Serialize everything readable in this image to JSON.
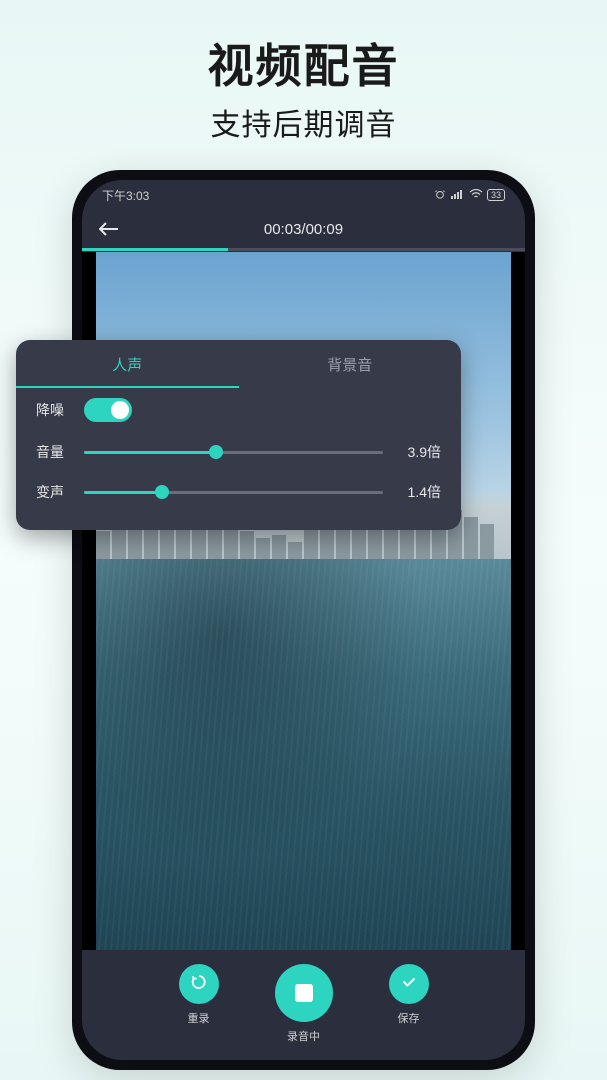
{
  "promo": {
    "title": "视频配音",
    "subtitle": "支持后期调音"
  },
  "status": {
    "time": "下午3:03",
    "battery": "33"
  },
  "header": {
    "timecode": "00:03/00:09"
  },
  "progress": {
    "percent": 33
  },
  "panel": {
    "tabs": {
      "voice": "人声",
      "bgm": "背景音"
    },
    "noise": {
      "label": "降噪",
      "on": true
    },
    "volume": {
      "label": "音量",
      "value": "3.9倍",
      "percent": 44
    },
    "pitch": {
      "label": "变声",
      "value": "1.4倍",
      "percent": 26
    }
  },
  "controls": {
    "rerecord": "重录",
    "recording": "录音中",
    "save": "保存"
  },
  "colors": {
    "accent": "#2dd4bf",
    "panel": "#363a49",
    "screen": "#2a2e3d"
  }
}
